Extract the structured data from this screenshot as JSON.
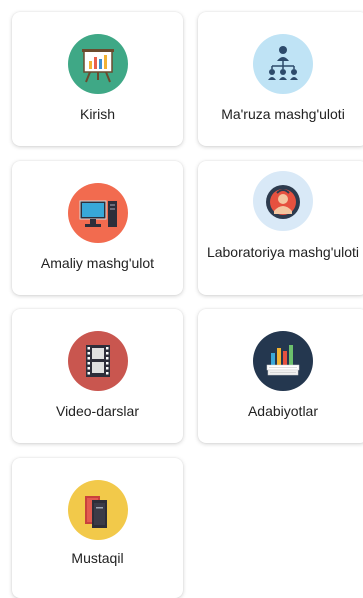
{
  "cards": [
    {
      "label": "Kirish",
      "icon": "presentation-board-icon",
      "color": "#3fa886"
    },
    {
      "label": "Ma'ruza mashg'uloti",
      "icon": "hierarchy-people-icon",
      "color": "#bfe3f5"
    },
    {
      "label": "Amaliy mashg'ulot",
      "icon": "computer-icon",
      "color": "#f26b4f"
    },
    {
      "label": "Laboratoriya mashg'uloti",
      "icon": "lab-person-icon",
      "color": "#d9e9f7"
    },
    {
      "label": "Video-darslar",
      "icon": "film-strip-icon",
      "color": "#c9564f"
    },
    {
      "label": "Adabiyotlar",
      "icon": "books-chart-icon",
      "color": "#24374f"
    },
    {
      "label": "Mustaqil",
      "icon": "book-stack-icon",
      "color": "#f2c94a"
    }
  ]
}
